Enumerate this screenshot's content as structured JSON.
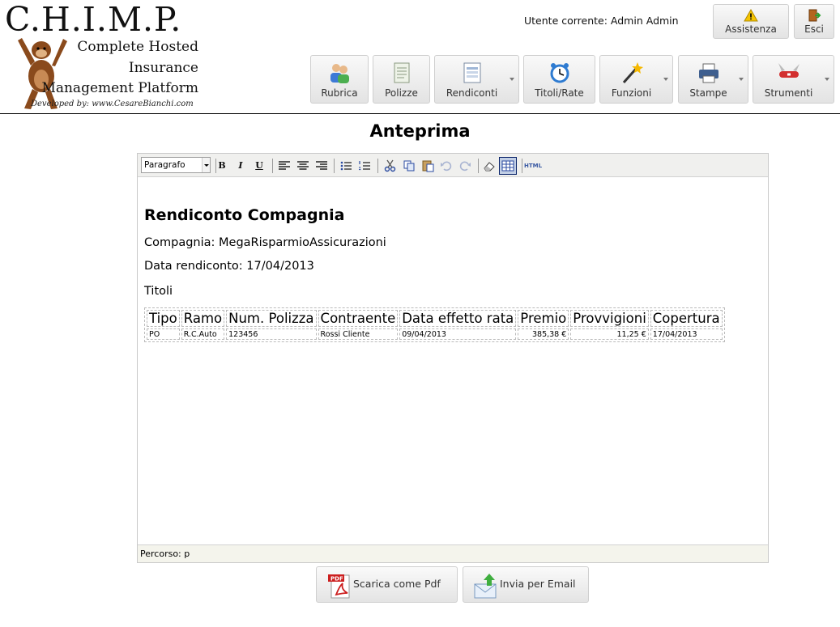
{
  "logo": {
    "title": "C.H.I.M.P.",
    "line1": "Complete Hosted",
    "line2": "Insurance",
    "line3": "Management Platform",
    "developed_by": "Developed by: www.CesareBianchi.com"
  },
  "user": {
    "label": "Utente corrente: Admin Admin"
  },
  "top_buttons": {
    "assistenza": "Assistenza",
    "esci": "Esci"
  },
  "nav": [
    {
      "label": "Rubrica",
      "icon": "contacts-icon"
    },
    {
      "label": "Polizze",
      "icon": "document-icon"
    },
    {
      "label": "Rendiconti",
      "icon": "report-icon"
    },
    {
      "label": "Titoli/Rate",
      "icon": "alarm-clock-icon"
    },
    {
      "label": "Funzioni",
      "icon": "magic-wand-icon"
    },
    {
      "label": "Stampe",
      "icon": "printer-icon"
    },
    {
      "label": "Strumenti",
      "icon": "swiss-knife-icon"
    }
  ],
  "page": {
    "title": "Anteprima"
  },
  "editor": {
    "format_select": "Paragrafo",
    "toolbar": {
      "bold": "B",
      "italic": "I",
      "underline": "U",
      "html": "HTML"
    },
    "status": "Percorso: p"
  },
  "document": {
    "heading": "Rendiconto Compagnia",
    "company": "Compagnia: MegaRisparmioAssicurazioni",
    "date": "Data rendiconto: 17/04/2013",
    "section": "Titoli",
    "table": {
      "headers": [
        "Tipo",
        "Ramo",
        "Num. Polizza",
        "Contraente",
        "Data effetto rata",
        "Premio",
        "Provvigioni",
        "Copertura"
      ],
      "rows": [
        [
          "PO",
          "R.C.Auto",
          "123456",
          "Rossi Cliente",
          "09/04/2013",
          "385,38 €",
          "11,25 €",
          "17/04/2013"
        ]
      ]
    }
  },
  "actions": {
    "pdf": "Scarica come Pdf",
    "email": "Invia per Email"
  },
  "colors": {
    "accent_blue": "#3a5aa3",
    "pdf_red": "#cc1f1f",
    "email_green": "#3fae3f"
  }
}
